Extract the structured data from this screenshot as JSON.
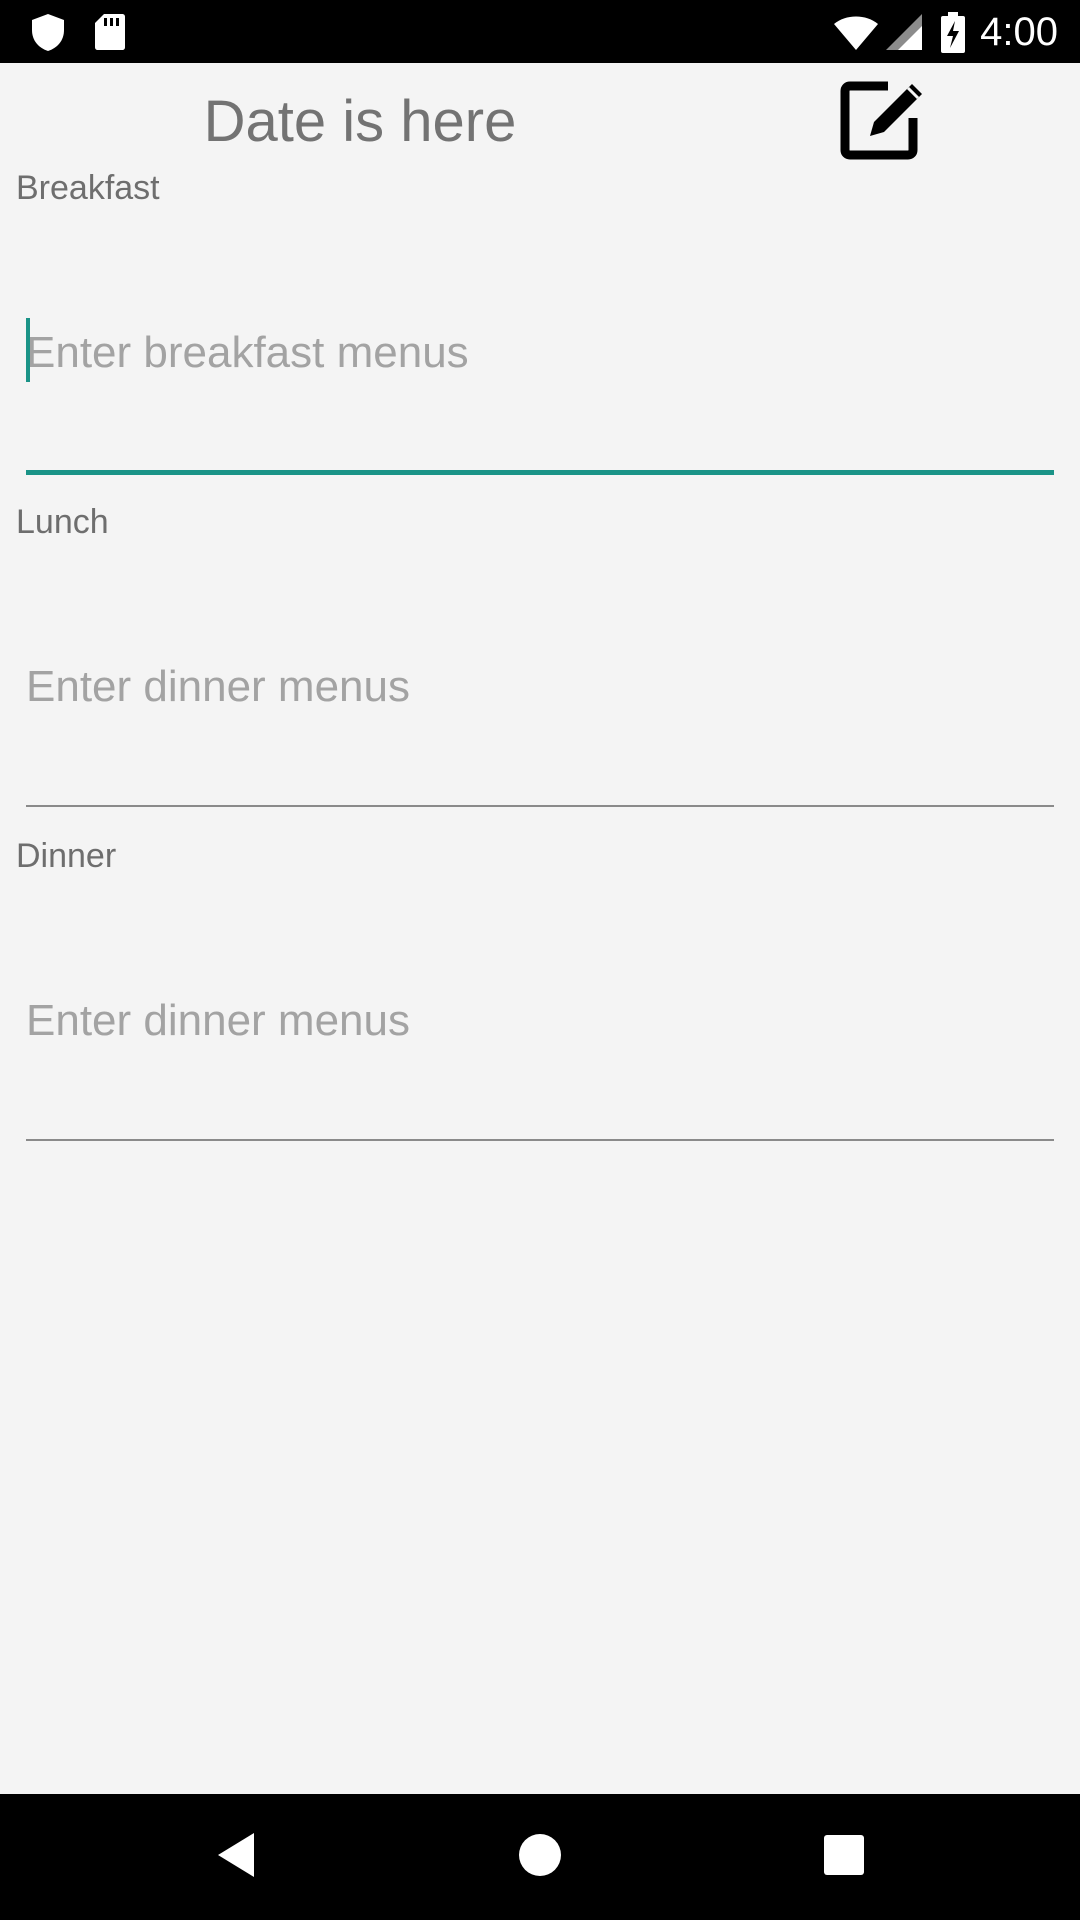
{
  "status_bar": {
    "time": "4:00",
    "icons": [
      "shield-icon",
      "sd-card-icon",
      "wifi-icon",
      "cellular-signal-icon",
      "battery-charging-icon"
    ]
  },
  "header": {
    "title": "Date is here",
    "edit_icon": "edit-icon"
  },
  "sections": [
    {
      "label": "Breakfast",
      "placeholder": "Enter breakfast menus",
      "value": "",
      "focused": true
    },
    {
      "label": "Lunch",
      "placeholder": "Enter dinner menus",
      "value": "",
      "focused": false
    },
    {
      "label": "Dinner",
      "placeholder": "Enter dinner menus",
      "value": "",
      "focused": false
    }
  ],
  "nav_bar": {
    "buttons": [
      "back-icon",
      "home-icon",
      "recents-icon"
    ]
  },
  "colors": {
    "accent": "#1a9387",
    "background": "#f4f4f4",
    "label_text": "#6e6e6e",
    "placeholder_text": "#a3a3a3"
  }
}
